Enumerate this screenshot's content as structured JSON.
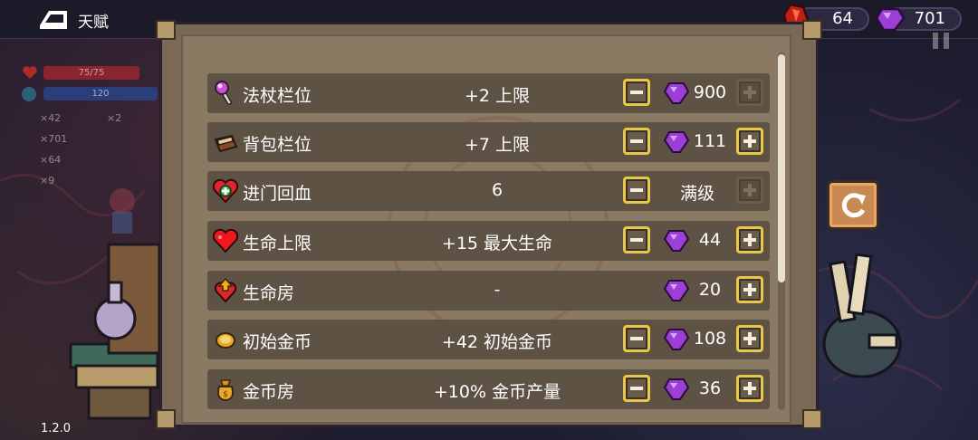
{
  "header": {
    "title": "天赋"
  },
  "resources": {
    "blood_value": "64",
    "gem_value": "701"
  },
  "hud": {
    "hp_text": "75/75",
    "mana_text": "120",
    "coins": "×42",
    "keys": "×2",
    "gems": "×701",
    "blood": "×64",
    "other": "×9"
  },
  "version": "1.2.0",
  "talents": [
    {
      "name": "法杖栏位",
      "effect": "+2 上限",
      "cost": "900",
      "icon": "wand-icon",
      "minus_active": true,
      "plus_active": false,
      "maxed": false
    },
    {
      "name": "背包栏位",
      "effect": "+7 上限",
      "cost": "111",
      "icon": "backpack-icon",
      "minus_active": true,
      "plus_active": true,
      "maxed": false
    },
    {
      "name": "进门回血",
      "effect": "6",
      "cost": "",
      "maxed_label": "满级",
      "icon": "heart-plus-icon",
      "minus_active": true,
      "plus_active": false,
      "maxed": true
    },
    {
      "name": "生命上限",
      "effect": "+15 最大生命",
      "cost": "44",
      "icon": "heart-icon",
      "minus_active": true,
      "plus_active": true,
      "maxed": false
    },
    {
      "name": "生命房",
      "effect": "-",
      "cost": "20",
      "icon": "heart-room-icon",
      "minus_active": false,
      "plus_active": true,
      "maxed": false
    },
    {
      "name": "初始金币",
      "effect": "+42 初始金币",
      "cost": "108",
      "icon": "coin-icon",
      "minus_active": true,
      "plus_active": true,
      "maxed": false
    },
    {
      "name": "金币房",
      "effect": "+10% 金币产量",
      "cost": "36",
      "icon": "money-bag-icon",
      "minus_active": true,
      "plus_active": true,
      "maxed": false
    }
  ],
  "colors": {
    "gem": "#9b3fd6",
    "blood": "#c0201a",
    "button_border_active": "#e8c84a",
    "row_bg": "#5e5244",
    "panel_bg": "#8a7a63"
  }
}
